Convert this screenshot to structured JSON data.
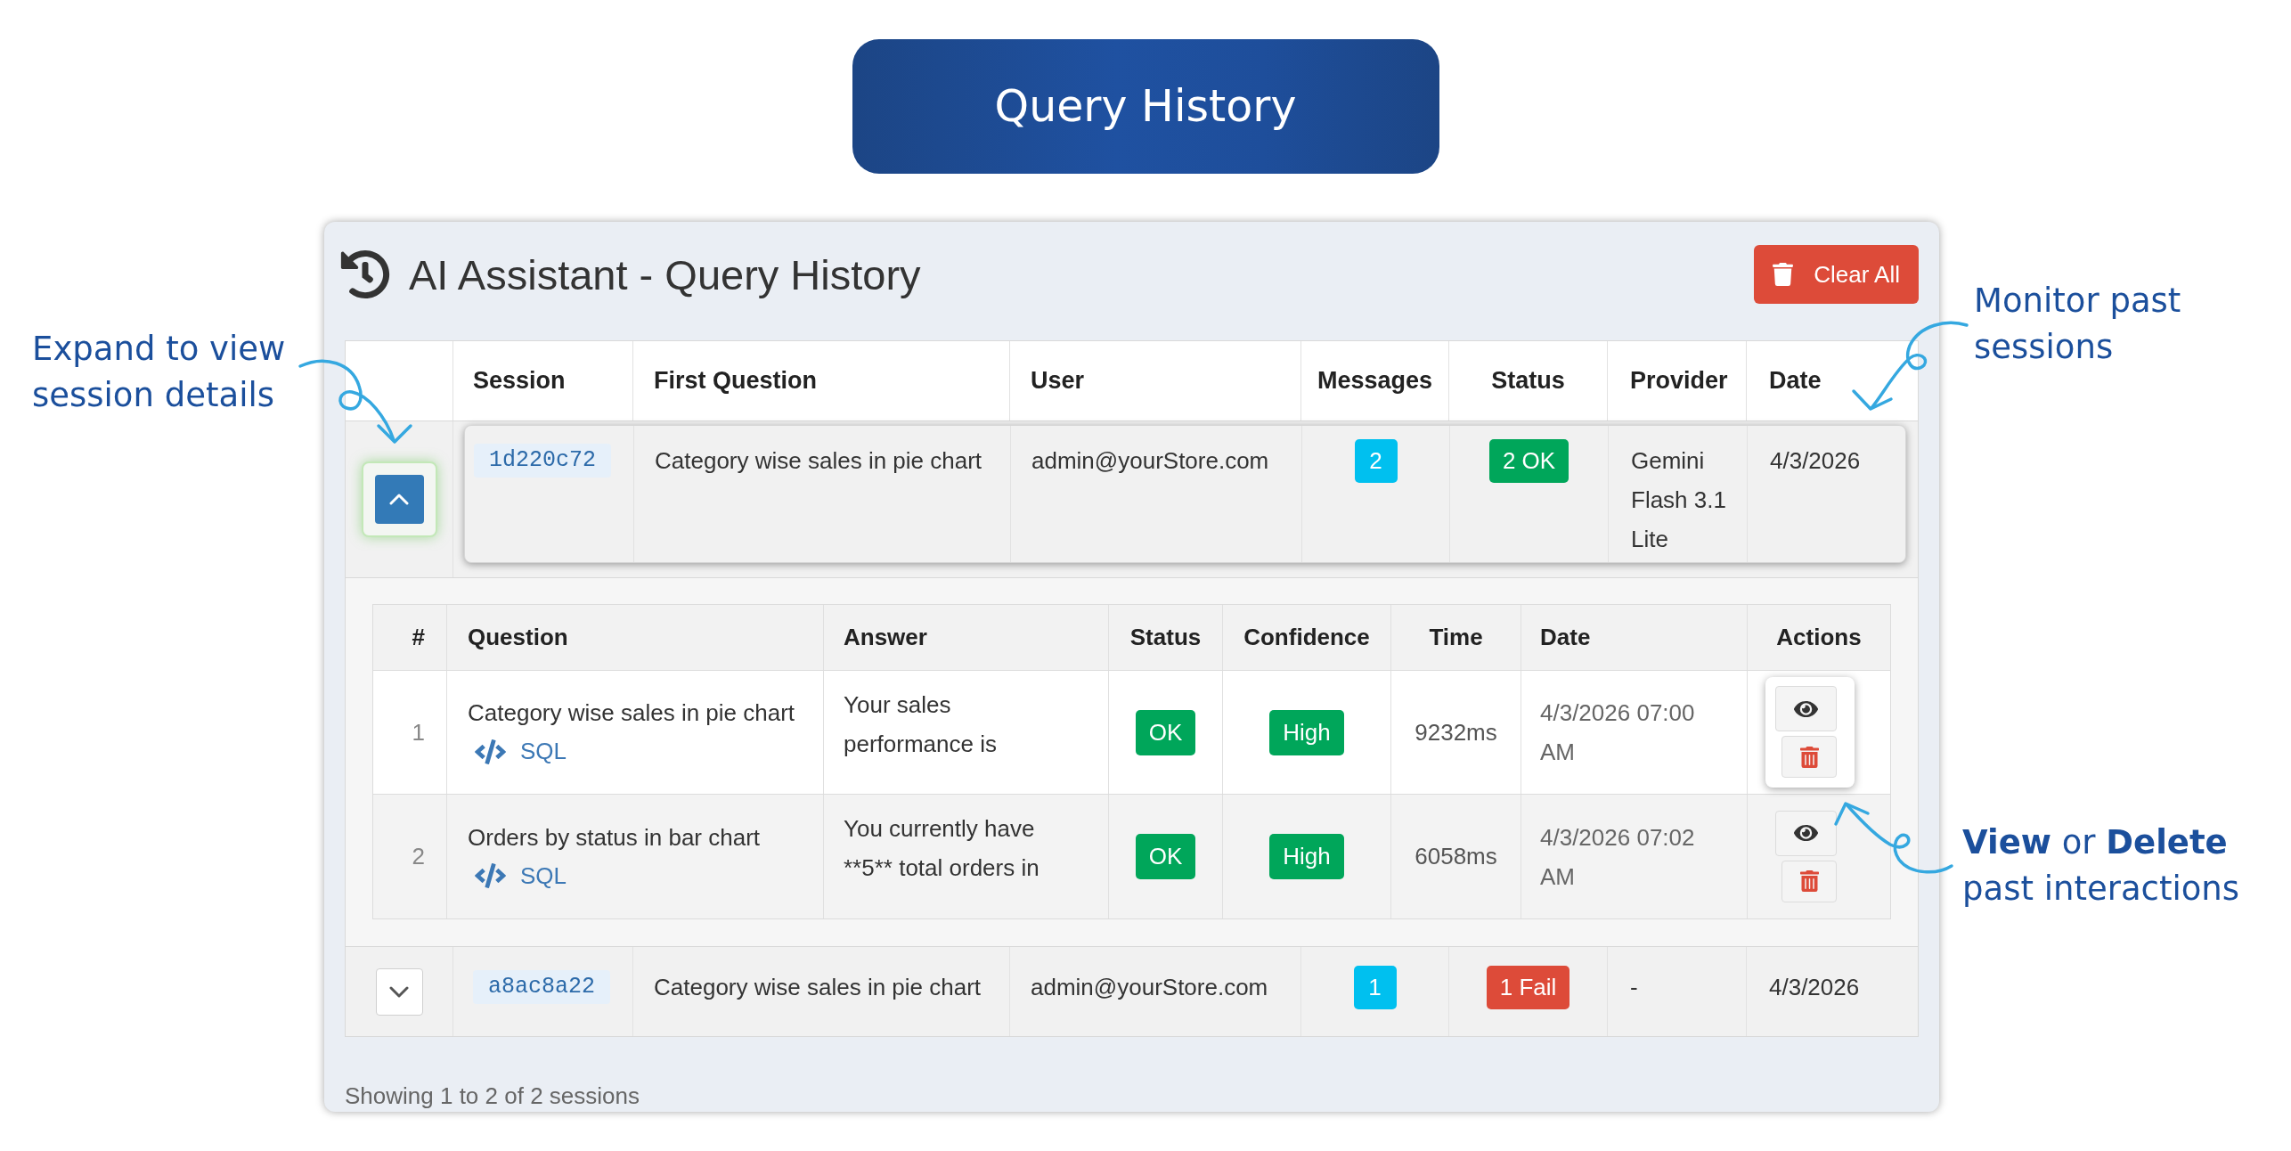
{
  "banner": {
    "title": "Query History"
  },
  "panel": {
    "title": "AI Assistant - Query History",
    "clear_button": "Clear All"
  },
  "table": {
    "columns": [
      "Session",
      "First Question",
      "User",
      "Messages",
      "Status",
      "Provider",
      "Date"
    ]
  },
  "sessions": [
    {
      "id": "1d220c72",
      "first_question": "Category wise sales in pie chart",
      "user": "admin@yourStore.com",
      "messages": "2",
      "status": {
        "text": "2 OK",
        "color": "#00a65a"
      },
      "provider": "Gemini Flash 3.1 Lite",
      "date": "4/3/2026",
      "expanded": true,
      "highlighted": true,
      "details": {
        "columns": [
          "#",
          "Question",
          "Answer",
          "Status",
          "Confidence",
          "Time",
          "Date",
          "Actions"
        ],
        "rows": [
          {
            "number": "1",
            "question": "Category wise sales in pie chart",
            "sql_link": "SQL",
            "answer": "Your sales performance is",
            "status": {
              "text": "OK",
              "color": "#00a65a"
            },
            "confidence": {
              "text": "High",
              "color": "#00a65a"
            },
            "time": "9232ms",
            "date": "4/3/2026 07:00 AM",
            "highlighted": true
          },
          {
            "number": "2",
            "question": "Orders by status in bar chart",
            "sql_link": "SQL",
            "answer": "You currently have **5** total orders in",
            "status": {
              "text": "OK",
              "color": "#00a65a"
            },
            "confidence": {
              "text": "High",
              "color": "#00a65a"
            },
            "time": "6058ms",
            "date": "4/3/2026 07:02 AM",
            "highlighted": false
          }
        ]
      }
    },
    {
      "id": "a8ac8a22",
      "first_question": "Category wise sales in pie chart",
      "user": "admin@yourStore.com",
      "messages": "1",
      "status": {
        "text": "1 Fail",
        "color": "#dd4b39"
      },
      "provider": "-",
      "date": "4/3/2026",
      "expanded": false,
      "highlighted": false
    }
  ],
  "footer": "Showing 1 to 2 of 2 sessions",
  "annotations": [
    "Expand to view session details",
    "Monitor past sessions",
    "**View** or **Delete** past interactions"
  ]
}
